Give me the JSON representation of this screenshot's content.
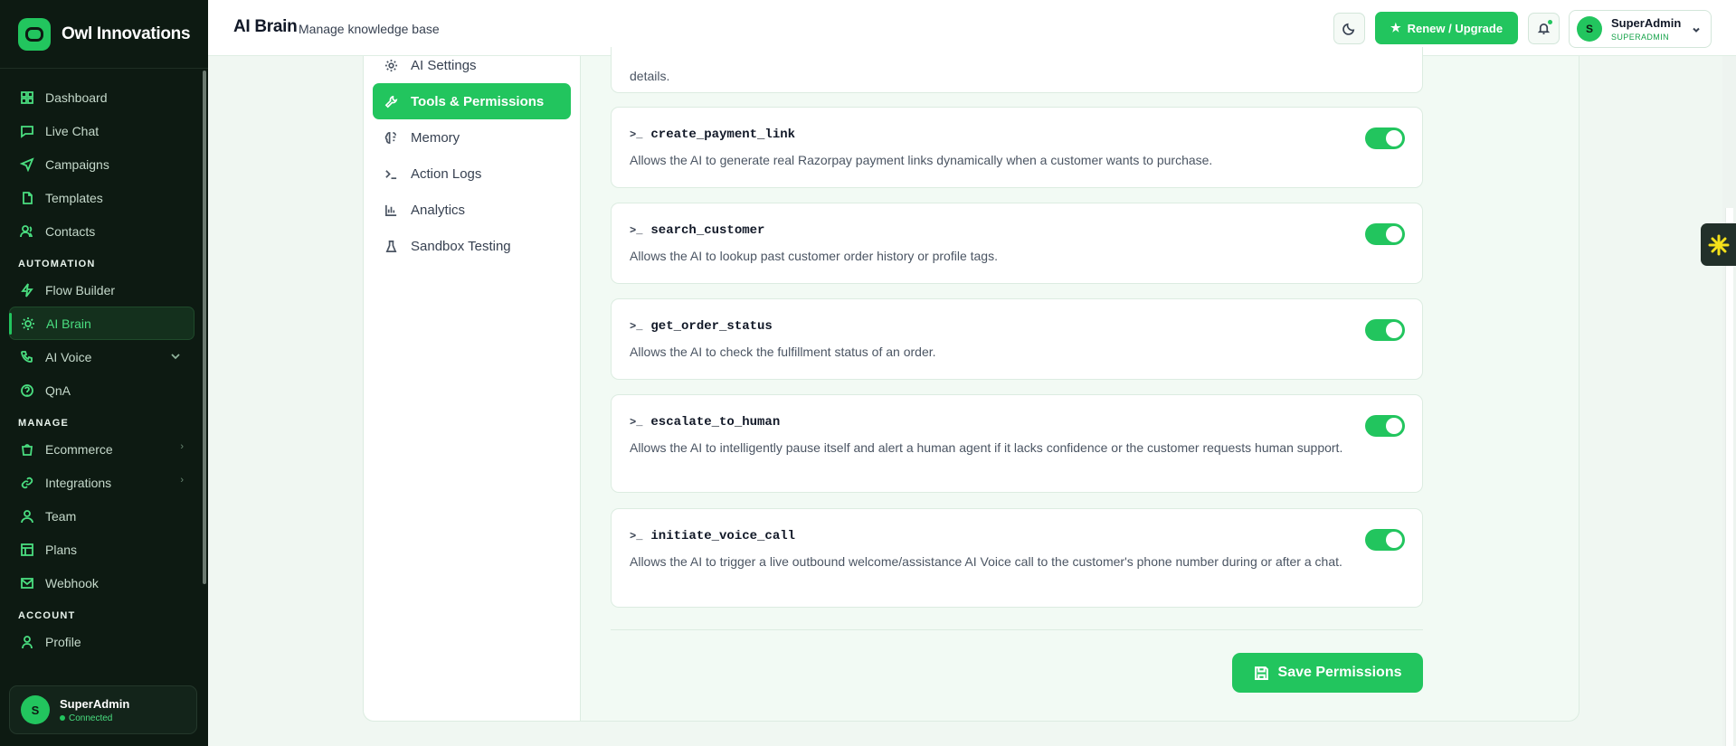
{
  "brand": {
    "name": "Owl Innovations"
  },
  "sidebar": {
    "items": [
      {
        "label": "Dashboard",
        "icon": "dashboard-icon"
      },
      {
        "label": "Live Chat",
        "icon": "chat-icon"
      },
      {
        "label": "Campaigns",
        "icon": "send-icon"
      },
      {
        "label": "Templates",
        "icon": "file-icon"
      },
      {
        "label": "Contacts",
        "icon": "users-icon"
      }
    ],
    "automation_title": "AUTOMATION",
    "automation": [
      {
        "label": "Flow Builder",
        "icon": "zap-icon"
      },
      {
        "label": "AI Brain",
        "icon": "sun-icon",
        "active": true
      },
      {
        "label": "AI Voice",
        "icon": "phone-icon"
      },
      {
        "label": "QnA",
        "icon": "help-icon"
      }
    ],
    "manage_title": "MANAGE",
    "manage": [
      {
        "label": "Ecommerce",
        "icon": "bag-icon"
      },
      {
        "label": "Integrations",
        "icon": "link-icon"
      },
      {
        "label": "Team",
        "icon": "team-icon"
      },
      {
        "label": "Plans",
        "icon": "table-icon"
      },
      {
        "label": "Webhook",
        "icon": "mail-icon"
      }
    ],
    "account_title": "ACCOUNT",
    "account": [
      {
        "label": "Profile",
        "icon": "user-icon"
      }
    ],
    "user": {
      "initial": "S",
      "name": "SuperAdmin",
      "status": "Connected"
    }
  },
  "header": {
    "title": "AI Brain",
    "subtitle": "Manage knowledge base",
    "upgrade_label": "Renew / Upgrade",
    "account": {
      "initial": "S",
      "name": "SuperAdmin",
      "role": "SUPERADMIN"
    }
  },
  "subnav": {
    "items": [
      {
        "label": "AI Settings",
        "icon": "settings-icon"
      },
      {
        "label": "Tools & Permissions",
        "icon": "wrench-icon",
        "active": true
      },
      {
        "label": "Memory",
        "icon": "brain-icon"
      },
      {
        "label": "Action Logs",
        "icon": "terminal-icon"
      },
      {
        "label": "Analytics",
        "icon": "bar-chart-icon"
      },
      {
        "label": "Sandbox Testing",
        "icon": "flask-icon"
      }
    ]
  },
  "tools": {
    "partial_text": "details.",
    "items": [
      {
        "name": "create_payment_link",
        "description": "Allows the AI to generate real Razorpay payment links dynamically when a customer wants to purchase.",
        "enabled": true
      },
      {
        "name": "search_customer",
        "description": "Allows the AI to lookup past customer order history or profile tags.",
        "enabled": true
      },
      {
        "name": "get_order_status",
        "description": "Allows the AI to check the fulfillment status of an order.",
        "enabled": true
      },
      {
        "name": "escalate_to_human",
        "description": "Allows the AI to intelligently pause itself and alert a human agent if it lacks confidence or the customer requests human support.",
        "enabled": true
      },
      {
        "name": "initiate_voice_call",
        "description": "Allows the AI to trigger a live outbound welcome/assistance AI Voice call to the customer's phone number during or after a chat.",
        "enabled": true
      }
    ],
    "save_label": "Save Permissions"
  },
  "colors": {
    "accent": "#22c55e",
    "sidebar_bg": "#0d1a12"
  }
}
